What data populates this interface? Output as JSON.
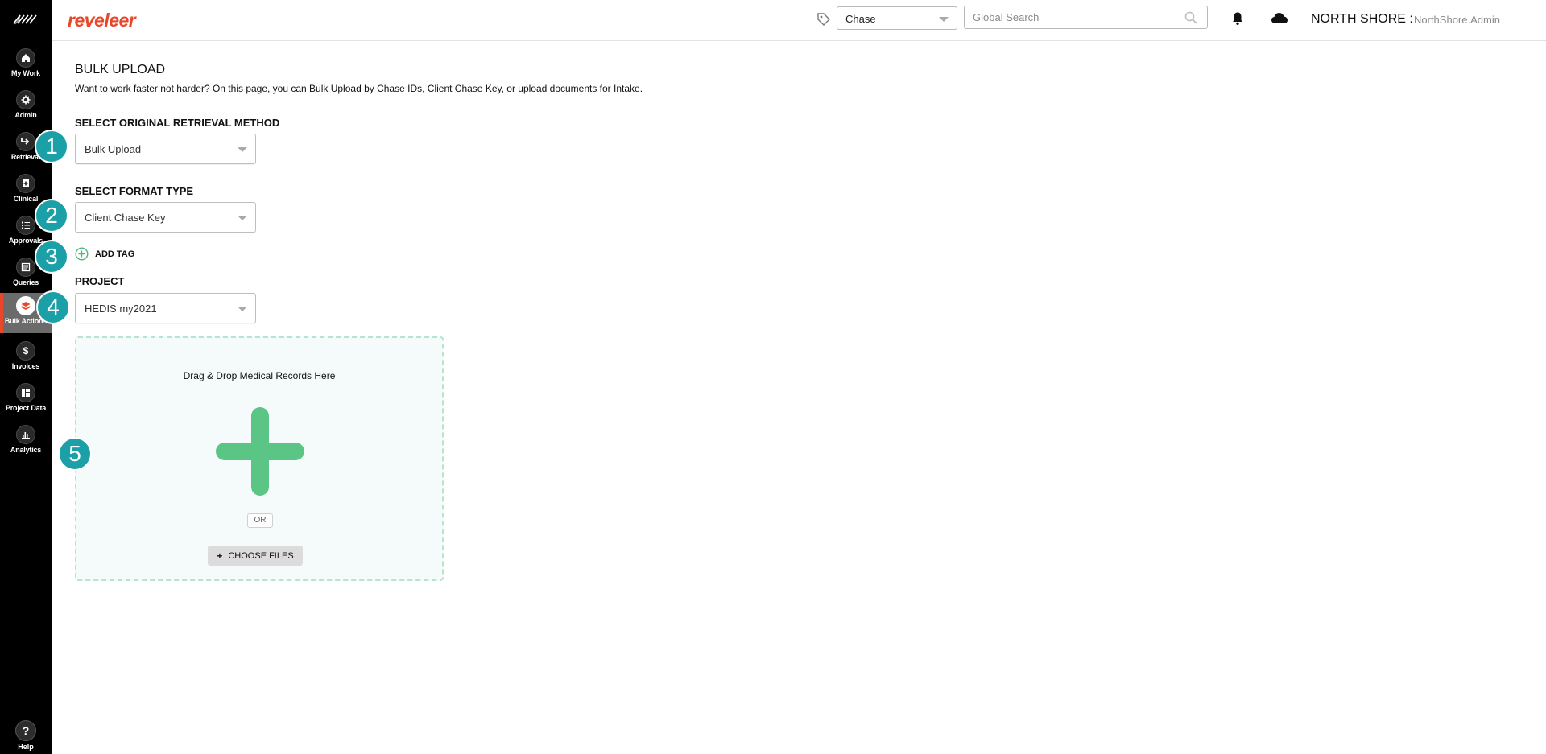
{
  "brand": {
    "name": "reveleer",
    "color": "#e8472a"
  },
  "sidebar": {
    "items": [
      {
        "label": "My Work",
        "icon": "home-icon"
      },
      {
        "label": "Admin",
        "icon": "gear-icon"
      },
      {
        "label": "Retrieval",
        "icon": "arrow-right-icon"
      },
      {
        "label": "Clinical",
        "icon": "clinical-doc-icon"
      },
      {
        "label": "Approvals",
        "icon": "checklist-icon"
      },
      {
        "label": "Queries",
        "icon": "list-icon"
      },
      {
        "label": "Bulk Actions",
        "icon": "layers-icon",
        "active": true
      },
      {
        "label": "Invoices",
        "icon": "dollar-icon"
      },
      {
        "label": "Project Data",
        "icon": "project-data-icon"
      },
      {
        "label": "Analytics",
        "icon": "bar-chart-icon"
      }
    ],
    "help_label": "Help",
    "help_glyph": "?"
  },
  "header": {
    "chase_select": "Chase",
    "search_placeholder": "Global Search",
    "org_name": "NORTH SHORE :",
    "user_name": "NorthShore.Admin"
  },
  "main": {
    "title": "BULK UPLOAD",
    "description": "Want to work faster not harder? On this page, you can Bulk Upload by Chase IDs, Client Chase Key, or upload documents for Intake.",
    "retrieval_label": "SELECT ORIGINAL RETRIEVAL METHOD",
    "retrieval_value": "Bulk Upload",
    "format_label": "SELECT FORMAT TYPE",
    "format_value": "Client Chase Key",
    "add_tag_label": "ADD TAG",
    "project_label": "PROJECT",
    "project_value": "HEDIS my2021",
    "dropzone": {
      "title": "Drag & Drop Medical Records Here",
      "or_label": "OR",
      "choose_plus": "+",
      "choose_label": "CHOOSE FILES"
    }
  },
  "callouts": [
    "1",
    "2",
    "3",
    "4",
    "5"
  ],
  "colors": {
    "accent_teal": "#1aa0a6",
    "plus_green": "#5bc585",
    "active_nav": "#6b6b6b"
  }
}
